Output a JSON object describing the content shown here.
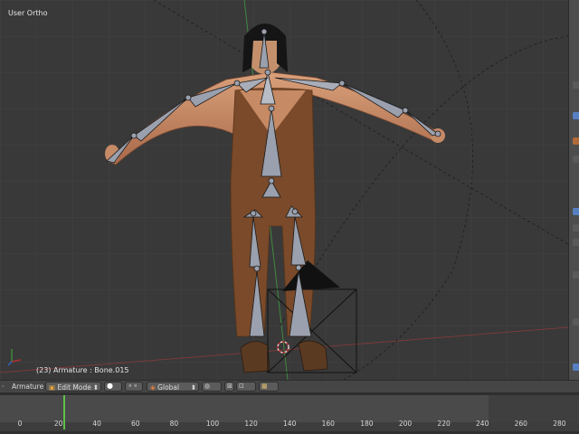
{
  "viewport": {
    "view_name": "User Ortho",
    "object_info": "(23) Armature : Bone.015"
  },
  "header": {
    "editor_menu": "Armature",
    "mode": {
      "label": "Edit Mode",
      "icon": "edit-mode-icon"
    },
    "shading_icon": "solid-shading-icon",
    "pivot_icon": "pivot-point-icon",
    "orientation": {
      "label": "Global",
      "icon": "transform-orientation-icon"
    },
    "layers_icon": "layer-icon",
    "snap_icon": "snap-icon",
    "render_icon": "render-icon"
  },
  "timeline": {
    "ruler_labels": [
      "0",
      "20",
      "40",
      "60",
      "80",
      "100",
      "120",
      "140",
      "160",
      "180",
      "200",
      "220",
      "240",
      "260",
      "280"
    ],
    "current_frame": 23
  },
  "colors": {
    "viewport_bg": "#393939",
    "playhead": "#5ec24a",
    "accent": "#5680c2"
  }
}
